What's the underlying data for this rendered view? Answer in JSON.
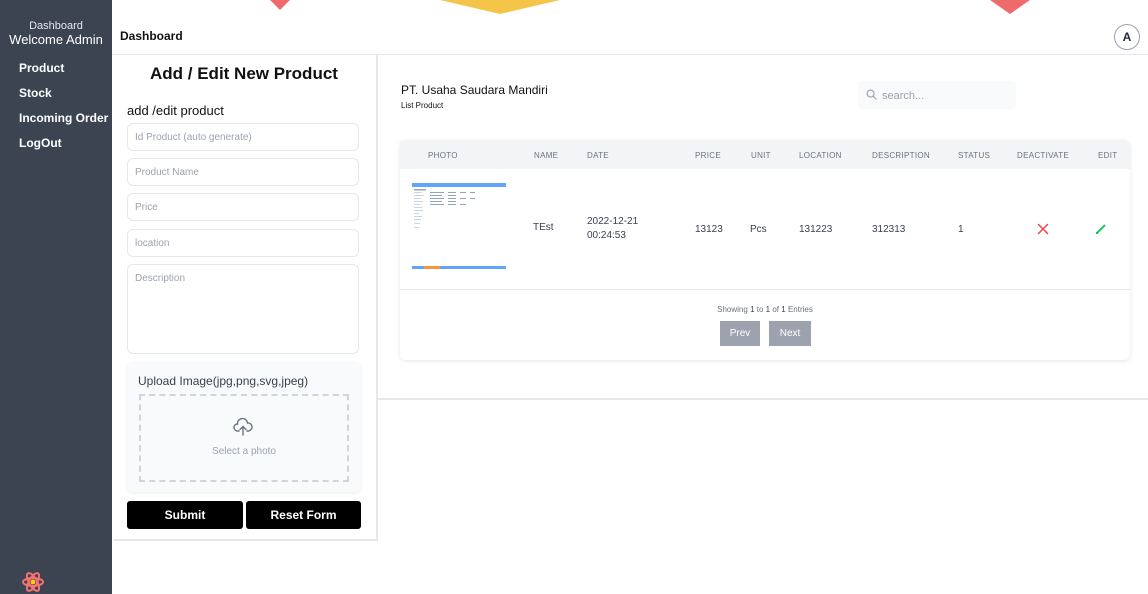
{
  "sidebar": {
    "title": "Dashboard",
    "welcome": "Welcome Admin",
    "items": [
      {
        "label": "Product"
      },
      {
        "label": "Stock"
      },
      {
        "label": "Incoming Order"
      },
      {
        "label": "LogOut"
      }
    ],
    "logo_icon": "react-atom-icon"
  },
  "header": {
    "title": "Dashboard",
    "avatar_letter": "A"
  },
  "form": {
    "heading": "Add / Edit New Product",
    "subheading": "add /edit product",
    "fields": {
      "id_placeholder": "Id Product (auto generate)",
      "name_placeholder": "Product Name",
      "price_placeholder": "Price",
      "location_placeholder": "location",
      "description_placeholder": "Description"
    },
    "upload": {
      "label": "Upload Image(jpg,png,svg,jpeg)",
      "hint": "Select a photo",
      "icon": "cloud-upload-icon"
    },
    "submit_label": "Submit",
    "reset_label": "Reset Form"
  },
  "list": {
    "company": "PT. Usaha Saudara Mandiri",
    "label": "List Product",
    "search_placeholder": "search...",
    "columns": [
      "PHOTO",
      "NAME",
      "DATE",
      "PRICE",
      "UNIT",
      "LOCATION",
      "DESCRIPTION",
      "STATUS",
      "DEACTIVATE",
      "EDIT"
    ],
    "rows": [
      {
        "name": "TEst",
        "date_line1": "2022-12-21",
        "date_line2": "00:24:53",
        "price": "13123",
        "unit": "Pcs",
        "location": "131223",
        "description": "312313",
        "status": "1",
        "deactivate_icon": "x-icon",
        "edit_icon": "pencil-icon"
      }
    ],
    "pagination": {
      "showing": "Showing",
      "from": "1",
      "to_word": "to",
      "to": "1",
      "of_word": "of",
      "total": "1",
      "entries": "Entries",
      "prev_label": "Prev",
      "next_label": "Next"
    }
  },
  "colors": {
    "sidebar_bg": "#3c4452",
    "button_black": "#000000",
    "pager_button": "#9ca3af",
    "deactivate_red": "#ef4444",
    "edit_green": "#22c55e"
  }
}
